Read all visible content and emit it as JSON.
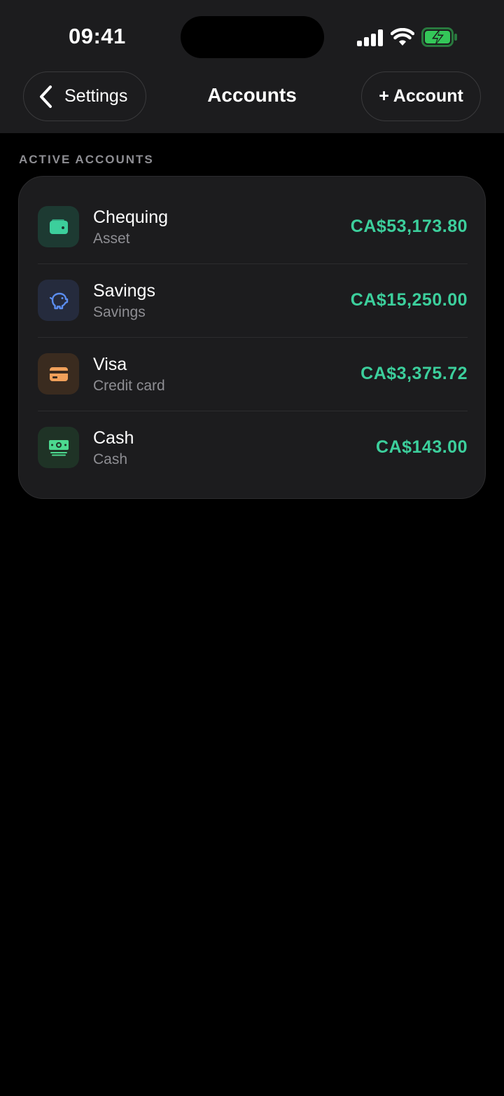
{
  "status_bar": {
    "time": "09:41"
  },
  "nav": {
    "back_label": "Settings",
    "title": "Accounts",
    "add_label": "+ Account"
  },
  "section": {
    "label": "ACTIVE ACCOUNTS"
  },
  "accounts": [
    {
      "name": "Chequing",
      "type": "Asset",
      "amount": "CA$53,173.80",
      "icon": "wallet-icon",
      "icon_color": "#3ccf9c",
      "icon_bg": "#1d3a32"
    },
    {
      "name": "Savings",
      "type": "Savings",
      "amount": "CA$15,250.00",
      "icon": "piggy-bank-icon",
      "icon_color": "#5b8def",
      "icon_bg": "#252b3d"
    },
    {
      "name": "Visa",
      "type": "Credit card",
      "amount": "CA$3,375.72",
      "icon": "credit-card-icon",
      "icon_color": "#f0a05a",
      "icon_bg": "#3a2b1f"
    },
    {
      "name": "Cash",
      "type": "Cash",
      "amount": "CA$143.00",
      "icon": "cash-icon",
      "icon_color": "#4cd98f",
      "icon_bg": "#1f3326"
    }
  ],
  "colors": {
    "amount_positive": "#3ccf9c",
    "background": "#000000",
    "surface": "#1c1c1e",
    "battery_fill": "#34c759"
  }
}
